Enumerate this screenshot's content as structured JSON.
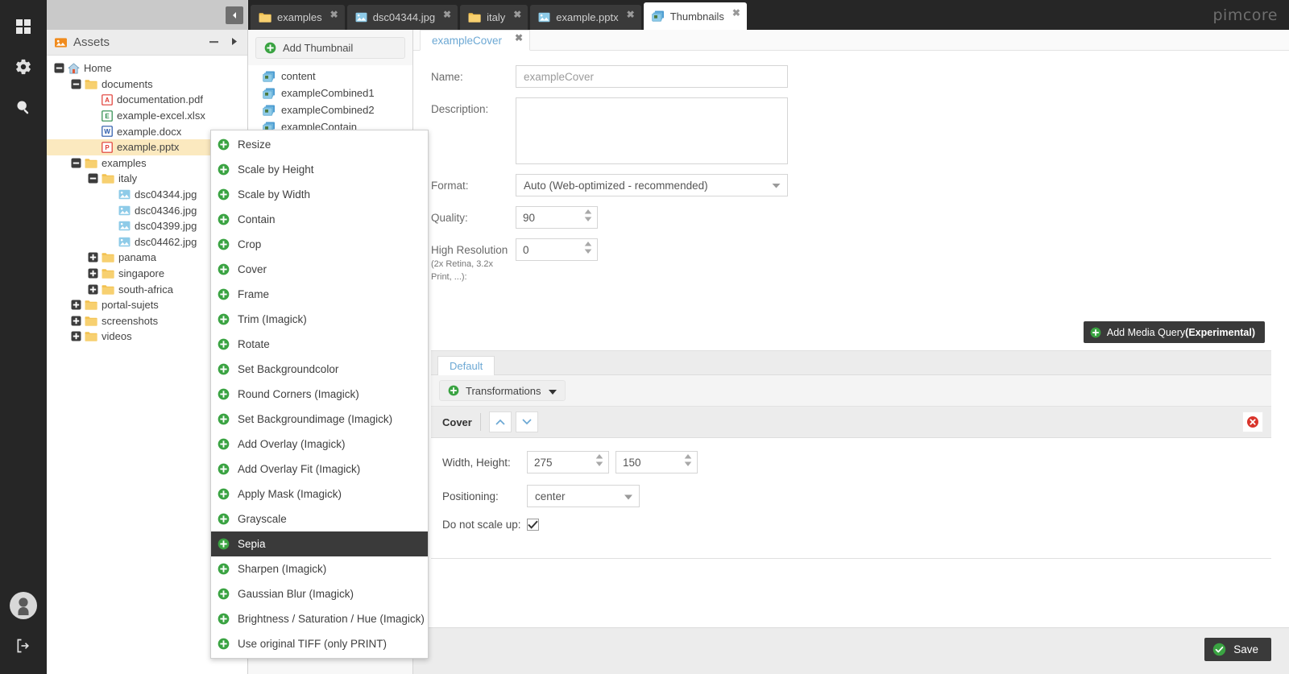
{
  "app": {
    "logo": "pimcore"
  },
  "rail": {
    "items": [
      {
        "name": "dashboard-icon",
        "label": "Dashboard"
      },
      {
        "name": "settings-icon",
        "label": "Settings"
      },
      {
        "name": "search-icon",
        "label": "Search"
      }
    ],
    "bottom": [
      {
        "name": "user-avatar-icon",
        "label": "User"
      },
      {
        "name": "logout-icon",
        "label": "Logout"
      }
    ]
  },
  "tabs": [
    {
      "label": "examples",
      "icon": "folder-icon",
      "active": false
    },
    {
      "label": "dsc04344.jpg",
      "icon": "image-icon",
      "active": false
    },
    {
      "label": "italy",
      "icon": "folder-icon",
      "active": false
    },
    {
      "label": "example.pptx",
      "icon": "image-icon",
      "active": false
    },
    {
      "label": "Thumbnails",
      "icon": "thumbnails-icon",
      "active": true
    }
  ],
  "tree_panel": {
    "header": {
      "title": "Assets",
      "icon": "assets-icon"
    },
    "nodes": [
      {
        "label": "Home",
        "icon": "home-icon",
        "indent": 0,
        "expander": "minus",
        "selected": false
      },
      {
        "label": "documents",
        "icon": "folder-icon",
        "indent": 1,
        "expander": "minus",
        "selected": false
      },
      {
        "label": "documentation.pdf",
        "icon": "pdf-icon",
        "indent": 2,
        "expander": "none",
        "selected": false
      },
      {
        "label": "example-excel.xlsx",
        "icon": "excel-icon",
        "indent": 2,
        "expander": "none",
        "selected": false
      },
      {
        "label": "example.docx",
        "icon": "word-icon",
        "indent": 2,
        "expander": "none",
        "selected": false
      },
      {
        "label": "example.pptx",
        "icon": "powerpoint-icon",
        "indent": 2,
        "expander": "none",
        "selected": true
      },
      {
        "label": "examples",
        "icon": "folder-icon",
        "indent": 1,
        "expander": "minus",
        "selected": false
      },
      {
        "label": "italy",
        "icon": "folder-icon",
        "indent": 2,
        "expander": "minus",
        "selected": false
      },
      {
        "label": "dsc04344.jpg",
        "icon": "image-icon",
        "indent": 3,
        "expander": "none",
        "selected": false
      },
      {
        "label": "dsc04346.jpg",
        "icon": "image-icon",
        "indent": 3,
        "expander": "none",
        "selected": false
      },
      {
        "label": "dsc04399.jpg",
        "icon": "image-icon",
        "indent": 3,
        "expander": "none",
        "selected": false
      },
      {
        "label": "dsc04462.jpg",
        "icon": "image-icon",
        "indent": 3,
        "expander": "none",
        "selected": false
      },
      {
        "label": "panama",
        "icon": "folder-icon",
        "indent": 2,
        "expander": "plus",
        "selected": false
      },
      {
        "label": "singapore",
        "icon": "folder-icon",
        "indent": 2,
        "expander": "plus",
        "selected": false
      },
      {
        "label": "south-africa",
        "icon": "folder-icon",
        "indent": 2,
        "expander": "plus",
        "selected": false
      },
      {
        "label": "portal-sujets",
        "icon": "folder-icon",
        "indent": 1,
        "expander": "plus",
        "selected": false
      },
      {
        "label": "screenshots",
        "icon": "folder-icon",
        "indent": 1,
        "expander": "plus",
        "selected": false
      },
      {
        "label": "videos",
        "icon": "folder-icon",
        "indent": 1,
        "expander": "plus",
        "selected": false
      }
    ]
  },
  "thumbnail_panel": {
    "add_button": "Add Thumbnail",
    "items": [
      {
        "label": "content"
      },
      {
        "label": "exampleCombined1"
      },
      {
        "label": "exampleCombined2"
      },
      {
        "label": "exampleContain"
      }
    ]
  },
  "transformations_menu": {
    "items": [
      {
        "label": "Resize",
        "highlighted": false
      },
      {
        "label": "Scale by Height",
        "highlighted": false
      },
      {
        "label": "Scale by Width",
        "highlighted": false
      },
      {
        "label": "Contain",
        "highlighted": false
      },
      {
        "label": "Crop",
        "highlighted": false
      },
      {
        "label": "Cover",
        "highlighted": false
      },
      {
        "label": "Frame",
        "highlighted": false
      },
      {
        "label": "Trim (Imagick)",
        "highlighted": false
      },
      {
        "label": "Rotate",
        "highlighted": false
      },
      {
        "label": "Set Backgroundcolor",
        "highlighted": false
      },
      {
        "label": "Round Corners (Imagick)",
        "highlighted": false
      },
      {
        "label": "Set Backgroundimage (Imagick)",
        "highlighted": false
      },
      {
        "label": "Add Overlay (Imagick)",
        "highlighted": false
      },
      {
        "label": "Add Overlay Fit (Imagick)",
        "highlighted": false
      },
      {
        "label": "Apply Mask (Imagick)",
        "highlighted": false
      },
      {
        "label": "Grayscale",
        "highlighted": false
      },
      {
        "label": "Sepia",
        "highlighted": true
      },
      {
        "label": "Sharpen (Imagick)",
        "highlighted": false
      },
      {
        "label": "Gaussian Blur (Imagick)",
        "highlighted": false
      },
      {
        "label": "Brightness / Saturation / Hue (Imagick)",
        "highlighted": false
      },
      {
        "label": "Use original TIFF (only PRINT)",
        "highlighted": false
      }
    ]
  },
  "editor": {
    "sub_tab": "exampleCover",
    "fields": {
      "name_label": "Name:",
      "name_value": "exampleCover",
      "description_label": "Description:",
      "description_value": "",
      "format_label": "Format:",
      "format_value": "Auto (Web-optimized - recommended)",
      "quality_label": "Quality:",
      "quality_value": "90",
      "high_res_label": "High Resolution",
      "high_res_sub": "(2x Retina, 3.2x Print, ...):",
      "high_res_value": "0"
    },
    "add_media_query": {
      "text": "Add Media Query ",
      "bold": "(Experimental)"
    },
    "default_tab": "Default",
    "transformations_button": "Transformations",
    "cover": {
      "title": "Cover",
      "width_height_label": "Width, Height:",
      "width_value": "275",
      "height_value": "150",
      "positioning_label": "Positioning:",
      "positioning_value": "center",
      "no_scale_up_label": "Do not scale up:",
      "no_scale_up_checked": true
    }
  },
  "footer": {
    "save_label": "Save"
  },
  "colors": {
    "rail_bg": "#262626",
    "accent_green": "#3aa342",
    "link_blue": "#6ca8d4",
    "selected_row": "#fbe9bf",
    "highlight_dark": "#3a3a3a",
    "danger_red": "#d9342b"
  }
}
